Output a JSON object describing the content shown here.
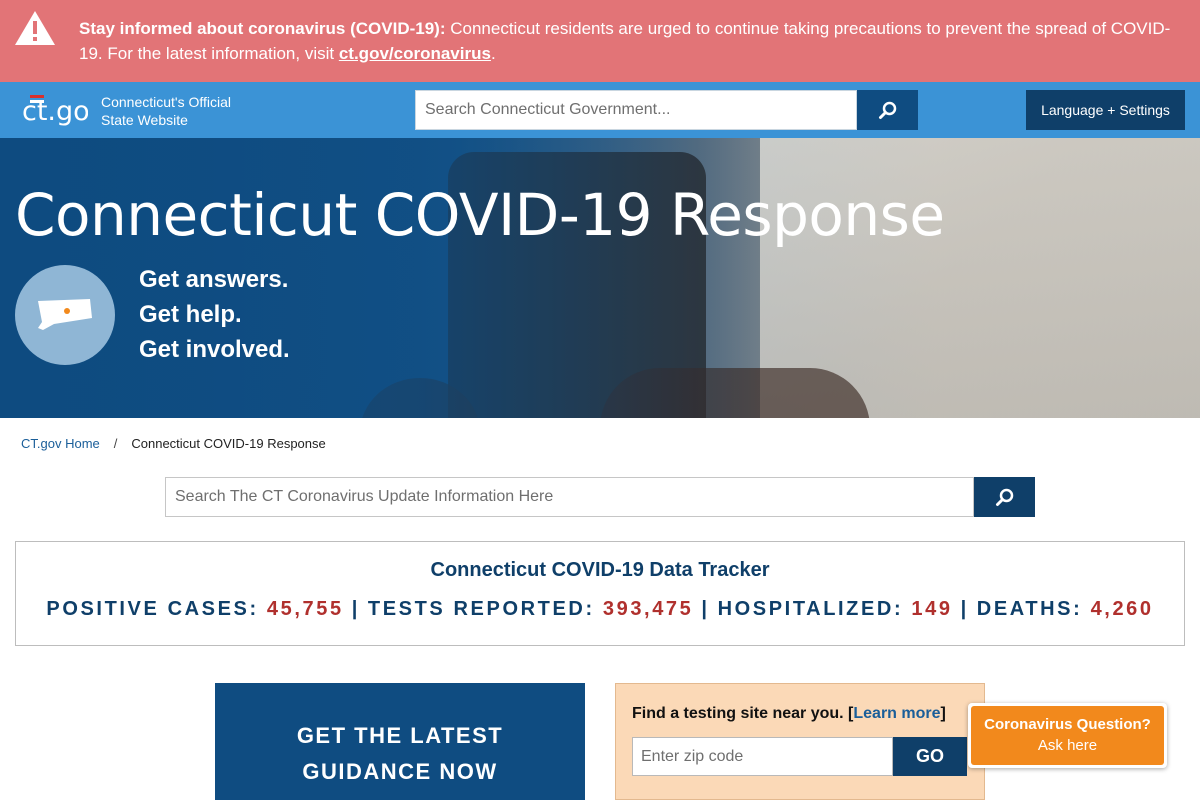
{
  "alert": {
    "icon": "warning-triangle-icon",
    "heading": "Stay informed about coronavirus (COVID-19):",
    "message": "Connecticut residents are urged to continue taking precautions to prevent the spread of COVID-19. For the latest information, visit",
    "link_text": "ct.gov/coronavirus",
    "trailing": ".",
    "bg_color": "#e27477"
  },
  "header": {
    "logo_text": "ct.gov",
    "site_name_line1": "Connecticut's Official",
    "site_name_line2": "State Website",
    "search_placeholder": "Search Connecticut Government...",
    "language_label": "Language + Settings",
    "bg_color": "#3b93d6"
  },
  "hero": {
    "title": "Connecticut COVID-19 Response",
    "taglines": [
      "Get answers.",
      "Get help.",
      "Get involved."
    ],
    "badge_icon": "connecticut-map-icon"
  },
  "breadcrumb": {
    "home": "CT.gov Home",
    "separator": "/",
    "current": "Connecticut COVID-19 Response"
  },
  "page_search": {
    "placeholder": "Search The CT Coronavirus Update Information Here"
  },
  "tracker": {
    "title": "Connecticut COVID-19 Data Tracker",
    "stats": [
      {
        "label": "POSITIVE CASES:",
        "value": "45,755"
      },
      {
        "label": "TESTS REPORTED:",
        "value": "393,475"
      },
      {
        "label": "HOSPITALIZED:",
        "value": "149"
      },
      {
        "label": "DEATHS:",
        "value": "4,260"
      }
    ],
    "separator": "|",
    "label_color": "#0f3f69",
    "value_color": "#b0302d"
  },
  "guidance": {
    "line1": "GET THE LATEST",
    "line2": "GUIDANCE NOW"
  },
  "testing": {
    "label": "Find a testing site near you.",
    "bracket_open": "[",
    "link_text": "Learn more",
    "bracket_close": "]",
    "zip_placeholder": "Enter zip code",
    "go_label": "GO"
  },
  "chat": {
    "line1": "Coronavirus Question?",
    "line2": "Ask here",
    "color": "#f2891c"
  }
}
